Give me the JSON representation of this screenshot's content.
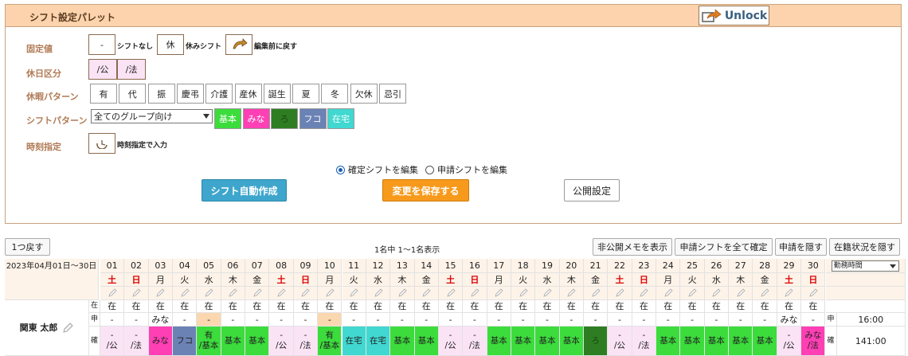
{
  "palette": {
    "title": "シフト設定パレット",
    "unlock_label": "Unlock",
    "rows": {
      "fixed": "固定値",
      "holiday_type": "休日区分",
      "leave_pattern": "休暇パターン",
      "shift_pattern": "シフトパターン",
      "time": "時刻指定"
    },
    "fixed_buttons": [
      {
        "label": "-",
        "side": "シフトなし"
      },
      {
        "label": "休",
        "side": "休みシフト"
      },
      {
        "label": "",
        "side": "編集前に戻す"
      }
    ],
    "holiday_buttons": [
      "/公",
      "/法"
    ],
    "leave_buttons": [
      "有",
      "代",
      "振",
      "慶弔",
      "介護",
      "産休",
      "誕生",
      "夏",
      "冬",
      "欠休",
      "忌引"
    ],
    "group_select": "全てのグループ向け",
    "shift_buttons": [
      {
        "label": "基本",
        "color": "#3cdc3c"
      },
      {
        "label": "みな",
        "color": "#ff3fb4"
      },
      {
        "label": "ろ",
        "color": "#2e7d22"
      },
      {
        "label": "フコ",
        "color": "#6b82b5"
      },
      {
        "label": "在宅",
        "color": "#40d8d0"
      }
    ],
    "time_side": "時刻指定で入力",
    "radio_confirmed": "確定シフトを編集",
    "radio_requested": "申請シフトを編集",
    "auto_create": "シフト自動作成",
    "save_changes": "変更を保存する",
    "publish_settings": "公開設定"
  },
  "toolbar": {
    "back": "1つ戻す",
    "count": "1名中 1〜1名表示",
    "show_memo": "非公開メモを表示",
    "confirm_all": "申請シフトを全て確定",
    "hide_request": "申請を隠す",
    "hide_status": "在籍状況を隠す"
  },
  "grid": {
    "range": "2023年04月01日〜30日",
    "summary_select": "勤務時間",
    "days": [
      {
        "d": "01",
        "w": "土"
      },
      {
        "d": "02",
        "w": "日"
      },
      {
        "d": "03",
        "w": "月"
      },
      {
        "d": "04",
        "w": "火"
      },
      {
        "d": "05",
        "w": "水"
      },
      {
        "d": "06",
        "w": "木"
      },
      {
        "d": "07",
        "w": "金"
      },
      {
        "d": "08",
        "w": "土"
      },
      {
        "d": "09",
        "w": "日"
      },
      {
        "d": "10",
        "w": "月"
      },
      {
        "d": "11",
        "w": "火"
      },
      {
        "d": "12",
        "w": "水"
      },
      {
        "d": "13",
        "w": "木"
      },
      {
        "d": "14",
        "w": "金"
      },
      {
        "d": "15",
        "w": "土"
      },
      {
        "d": "16",
        "w": "日"
      },
      {
        "d": "17",
        "w": "月"
      },
      {
        "d": "18",
        "w": "火"
      },
      {
        "d": "19",
        "w": "水"
      },
      {
        "d": "20",
        "w": "木"
      },
      {
        "d": "21",
        "w": "金"
      },
      {
        "d": "22",
        "w": "土"
      },
      {
        "d": "23",
        "w": "日"
      },
      {
        "d": "24",
        "w": "月"
      },
      {
        "d": "25",
        "w": "火"
      },
      {
        "d": "26",
        "w": "水"
      },
      {
        "d": "27",
        "w": "木"
      },
      {
        "d": "28",
        "w": "金"
      },
      {
        "d": "29",
        "w": "土"
      },
      {
        "d": "30",
        "w": "日"
      }
    ],
    "employee": {
      "name": "関東 太郎",
      "presence_label": "在",
      "request_label": "申",
      "confirmed_label": "確",
      "presence": [
        "在",
        "在",
        "在",
        "在",
        "在",
        "在",
        "在",
        "在",
        "在",
        "在",
        "在",
        "在",
        "在",
        "在",
        "在",
        "在",
        "在",
        "在",
        "在",
        "在",
        "在",
        "在",
        "在",
        "在",
        "在",
        "在",
        "在",
        "在",
        "在",
        "在"
      ],
      "requests": [
        "-",
        "-",
        "みな",
        "-",
        "-",
        "-",
        "-",
        "-",
        "-",
        "-",
        "-",
        "-",
        "-",
        "-",
        "-",
        "-",
        "-",
        "-",
        "-",
        "-",
        "-",
        "-",
        "-",
        "-",
        "-",
        "-",
        "-",
        "-",
        "みな",
        "-"
      ],
      "confirmed": [
        {
          "t": "-\n/公",
          "c": "#fbe3f6"
        },
        {
          "t": "-\n/法",
          "c": "#fbe3f6"
        },
        {
          "t": "みな",
          "c": "#ff3fb4"
        },
        {
          "t": "フコ",
          "c": "#6b82b5"
        },
        {
          "t": "有\n/基本",
          "c": "#3cdc3c"
        },
        {
          "t": "基本",
          "c": "#3cdc3c"
        },
        {
          "t": "基本",
          "c": "#3cdc3c"
        },
        {
          "t": "-\n/公",
          "c": "#fbe3f6"
        },
        {
          "t": "-\n/法",
          "c": "#fbe3f6"
        },
        {
          "t": "有\n/基本",
          "c": "#3cdc3c"
        },
        {
          "t": "在宅",
          "c": "#40d8d0"
        },
        {
          "t": "在宅",
          "c": "#40d8d0"
        },
        {
          "t": "基本",
          "c": "#3cdc3c"
        },
        {
          "t": "基本",
          "c": "#3cdc3c"
        },
        {
          "t": "-\n/公",
          "c": "#fbe3f6"
        },
        {
          "t": "-\n/法",
          "c": "#fbe3f6"
        },
        {
          "t": "基本",
          "c": "#3cdc3c"
        },
        {
          "t": "基本",
          "c": "#3cdc3c"
        },
        {
          "t": "基本",
          "c": "#3cdc3c"
        },
        {
          "t": "基本",
          "c": "#3cdc3c"
        },
        {
          "t": "ろ",
          "c": "#2e7d22"
        },
        {
          "t": "-\n/公",
          "c": "#fbe3f6"
        },
        {
          "t": "-\n/法",
          "c": "#fbe3f6"
        },
        {
          "t": "基本",
          "c": "#3cdc3c"
        },
        {
          "t": "基本",
          "c": "#3cdc3c"
        },
        {
          "t": "基本",
          "c": "#3cdc3c"
        },
        {
          "t": "基本",
          "c": "#3cdc3c"
        },
        {
          "t": "基本",
          "c": "#3cdc3c"
        },
        {
          "t": "-\n/公",
          "c": "#fbe3f6"
        },
        {
          "t": "みな\n/法",
          "c": "#ff3fb4"
        }
      ],
      "request_hours_label": "申",
      "request_hours": "16:00",
      "confirmed_hours_label": "確",
      "confirmed_hours": "141:00"
    }
  }
}
